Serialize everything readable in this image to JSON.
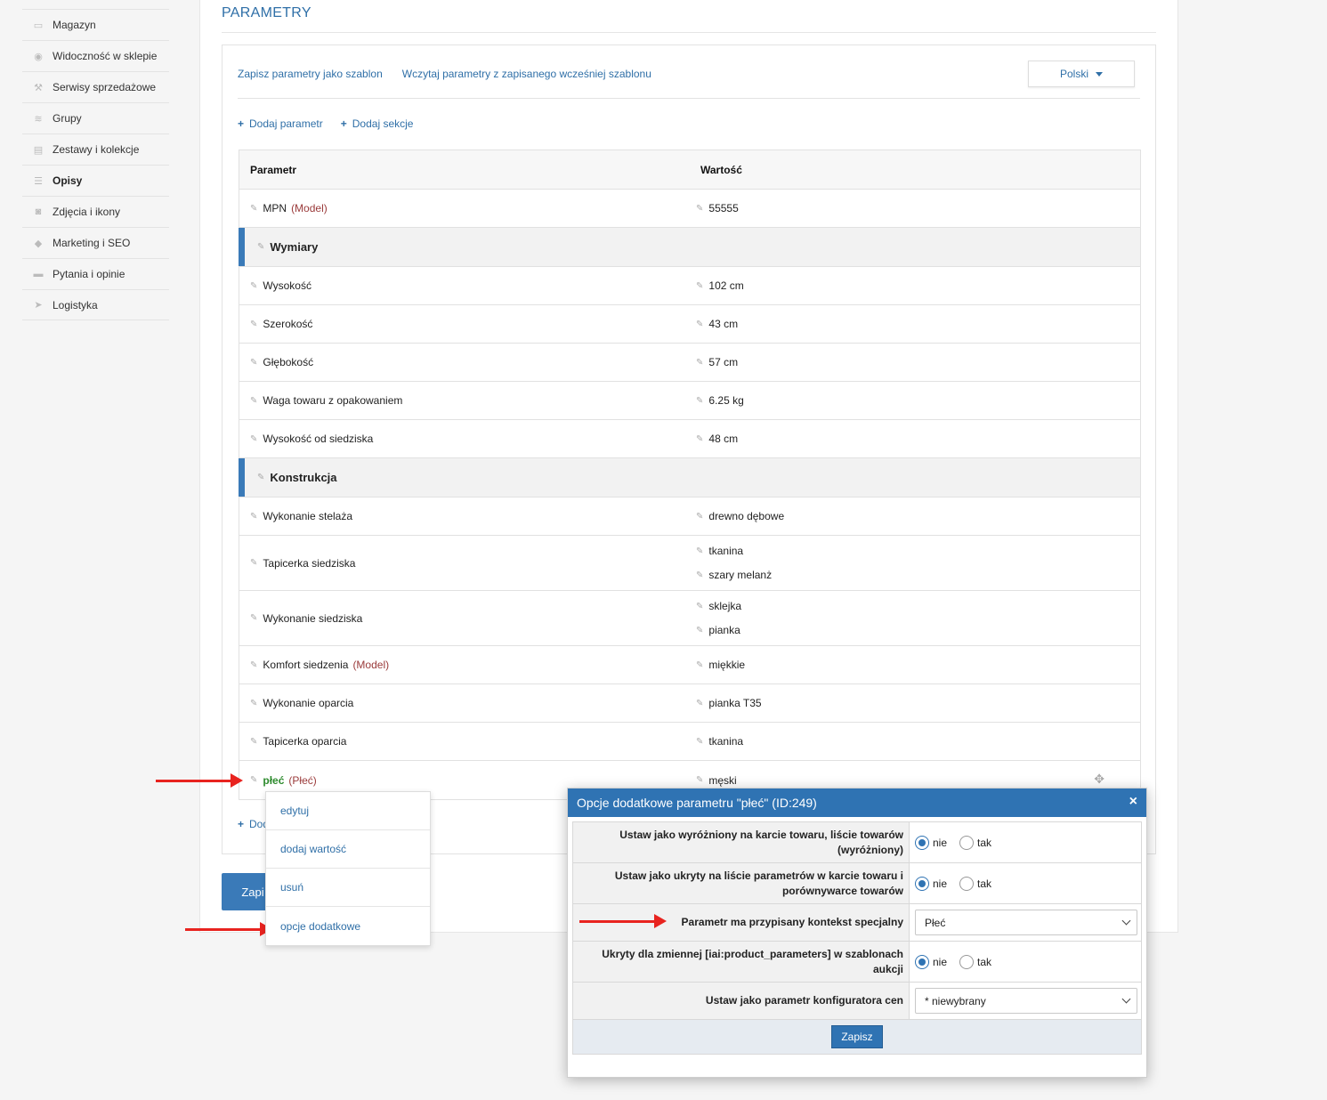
{
  "sidebar": {
    "items": [
      {
        "label": "Magazyn",
        "icon": "box-icon"
      },
      {
        "label": "Widoczność w sklepie",
        "icon": "eye-icon"
      },
      {
        "label": "Serwisy sprzedażowe",
        "icon": "hammer-icon"
      },
      {
        "label": "Grupy",
        "icon": "layers-icon"
      },
      {
        "label": "Zestawy i kolekcje",
        "icon": "collection-icon"
      },
      {
        "label": "Opisy",
        "icon": "list-icon"
      },
      {
        "label": "Zdjęcia i ikony",
        "icon": "camera-icon"
      },
      {
        "label": "Marketing i SEO",
        "icon": "tag-icon"
      },
      {
        "label": "Pytania i opinie",
        "icon": "chat-icon"
      },
      {
        "label": "Logistyka",
        "icon": "send-icon"
      }
    ]
  },
  "main": {
    "title": "PARAMETRY",
    "save_template": "Zapisz parametry jako szablon",
    "load_template": "Wczytaj parametry z zapisanego wcześniej szablonu",
    "language": "Polski",
    "add_param": "Dodaj parametr",
    "add_section": "Dodaj sekcje",
    "bottom_add": "Dod",
    "save": "Zapi"
  },
  "table": {
    "col_param": "Parametr",
    "col_value": "Wartość",
    "mpn": {
      "name": "MPN",
      "tag": "(Model)",
      "value": "55555"
    },
    "section1": "Wymiary",
    "r_height": {
      "name": "Wysokość",
      "value": "102 cm"
    },
    "r_width": {
      "name": "Szerokość",
      "value": "43 cm"
    },
    "r_depth": {
      "name": "Głębokość",
      "value": "57 cm"
    },
    "r_weight": {
      "name": "Waga towaru z opakowaniem",
      "value": "6.25 kg"
    },
    "r_seat_height": {
      "name": "Wysokość od siedziska",
      "value": "48 cm"
    },
    "section2": "Konstrukcja",
    "r_frame": {
      "name": "Wykonanie stelaża",
      "value": "drewno dębowe"
    },
    "r_seat_uph": {
      "name": "Tapicerka siedziska",
      "values": [
        "tkanina",
        "szary melanż"
      ]
    },
    "r_seat_make": {
      "name": "Wykonanie siedziska",
      "values": [
        "sklejka",
        "pianka"
      ]
    },
    "r_comfort": {
      "name": "Komfort siedzenia",
      "tag": "(Model)",
      "value": "miękkie"
    },
    "r_back_make": {
      "name": "Wykonanie oparcia",
      "value": "pianka T35"
    },
    "r_back_uph": {
      "name": "Tapicerka oparcia",
      "value": "tkanina"
    },
    "r_gender": {
      "name": "płeć",
      "tag": "(Płeć)",
      "value": "męski"
    }
  },
  "context_menu": {
    "edit": "edytuj",
    "add_value": "dodaj wartość",
    "remove": "usuń",
    "extra_options": "opcje dodatkowe"
  },
  "modal": {
    "title": "Opcje dodatkowe parametru \"płeć\" (ID:249)",
    "close": "×",
    "row1_label": "Ustaw jako wyróżniony na karcie towaru, liście towarów (wyróżniony)",
    "row2_label": "Ustaw jako ukryty na liście parametrów w karcie towaru i porównywarce towarów",
    "row3_label": "Parametr ma przypisany kontekst specjalny",
    "row3_value": "Płeć",
    "row4_label": "Ukryty dla zmiennej [iai:product_parameters] w szablonach aukcji",
    "row5_label": "Ustaw jako parametr konfiguratora cen",
    "row5_value": "* niewybrany",
    "no": "nie",
    "yes": "tak",
    "save": "Zapisz"
  },
  "colors": {
    "accent": "#2f73b3",
    "arrow": "#e8231f",
    "model_tag": "#9a3a3a",
    "green": "#2e8b2e"
  }
}
